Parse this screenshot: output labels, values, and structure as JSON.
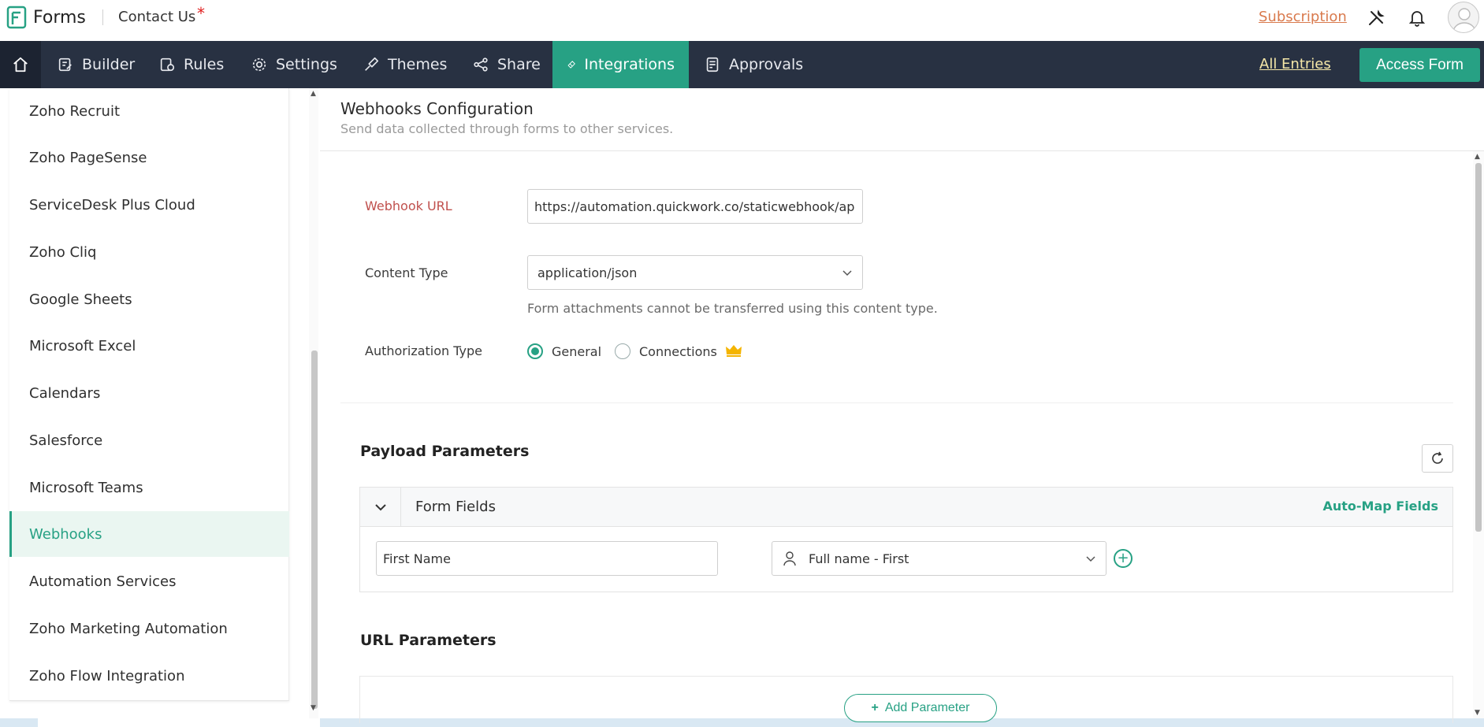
{
  "app": {
    "name": "Forms",
    "form_name": "Contact Us",
    "required_marker": "*"
  },
  "header": {
    "subscription_label": "Subscription"
  },
  "nav": {
    "items": [
      {
        "label": "Builder",
        "icon": "builder-icon"
      },
      {
        "label": "Rules",
        "icon": "rules-icon"
      },
      {
        "label": "Settings",
        "icon": "gear-icon"
      },
      {
        "label": "Themes",
        "icon": "brush-icon"
      },
      {
        "label": "Share",
        "icon": "share-icon"
      },
      {
        "label": "Integrations",
        "icon": "integrations-icon",
        "active": true
      },
      {
        "label": "Approvals",
        "icon": "approvals-icon"
      }
    ],
    "all_entries_label": "All Entries",
    "access_form_label": "Access Form"
  },
  "sidebar": {
    "items": [
      {
        "label": "Zoho Recruit"
      },
      {
        "label": "Zoho PageSense"
      },
      {
        "label": "ServiceDesk Plus Cloud"
      },
      {
        "label": "Zoho Cliq"
      },
      {
        "label": "Google Sheets"
      },
      {
        "label": "Microsoft Excel"
      },
      {
        "label": "Calendars"
      },
      {
        "label": "Salesforce"
      },
      {
        "label": "Microsoft Teams"
      },
      {
        "label": "Webhooks",
        "active": true
      },
      {
        "label": "Automation Services"
      },
      {
        "label": "Zoho Marketing Automation"
      },
      {
        "label": "Zoho Flow Integration"
      }
    ]
  },
  "webhook": {
    "title": "Webhooks Configuration",
    "subtitle": "Send data collected through forms to other services.",
    "url_label": "Webhook URL",
    "url_value": "https://automation.quickwork.co/staticwebhook/ap",
    "content_type_label": "Content Type",
    "content_type_value": "application/json",
    "content_type_hint": "Form attachments cannot be transferred using this content type.",
    "auth_label": "Authorization Type",
    "auth_options": [
      "General",
      "Connections"
    ],
    "auth_selected": "General"
  },
  "payload": {
    "title": "Payload Parameters",
    "form_fields_label": "Form Fields",
    "automap_label": "Auto-Map Fields",
    "rows": [
      {
        "key": "First Name",
        "field": "Full name - First"
      }
    ]
  },
  "url_params": {
    "title": "URL Parameters",
    "add_label": "Add Parameter"
  },
  "colors": {
    "accent": "#27a184",
    "nav_bg": "#283142",
    "required": "#c0504d",
    "subscription": "#d97a4d"
  }
}
